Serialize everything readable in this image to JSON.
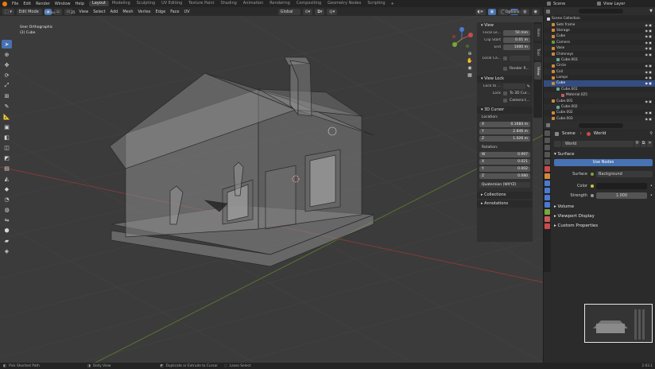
{
  "topbar": {
    "menus": [
      "File",
      "Edit",
      "Render",
      "Window",
      "Help"
    ],
    "workspaces": [
      "Layout",
      "Modeling",
      "Sculpting",
      "UV Editing",
      "Texture Paint",
      "Shading",
      "Animation",
      "Rendering",
      "Compositing",
      "Geometry Nodes",
      "Scripting"
    ],
    "active_workspace": "Layout",
    "scene": "Scene",
    "view_layer": "View Layer"
  },
  "viewport_header": {
    "mode": "Edit Mode",
    "menus": [
      "View",
      "Select",
      "Add",
      "Mesh",
      "Vertex",
      "Edge",
      "Face",
      "UV"
    ],
    "orientation": "Global",
    "options": "Options",
    "radius_label": "Radius",
    "radius_value": "25"
  },
  "viewport": {
    "view_name": "User Orthographic",
    "object_name": "(2) Cube"
  },
  "npanel": {
    "view_title": "View",
    "focal_label": "Focal Le...",
    "focal_value": "50 mm",
    "clip_start_label": "Clip Start",
    "clip_start_value": "0.01 m",
    "end_label": "End",
    "end_value": "1000 m",
    "local_camera_label": "Local Ca...",
    "render_region_label": "Render R...",
    "view_lock_title": "View Lock",
    "lock_to_label": "Lock to ...",
    "lock_label": "Lock",
    "to_3d_cursor_label": "To 3D Cur...",
    "camera_label": "Camera t...",
    "cursor_title": "3D Cursor",
    "location_label": "Location:",
    "loc_x": "0.1684 m",
    "loc_y": "2.846 m",
    "loc_z": "1.026 m",
    "rotation_label": "Rotation:",
    "rot_w": "0.997",
    "rot_x": "0.021",
    "rot_y": "0.002",
    "rot_z": "0.080",
    "rot_mode": "Quaternion (WXYZ)",
    "collections_title": "Collections",
    "annotations_title": "Annotations",
    "axis_x": "X",
    "axis_y": "Y",
    "axis_z": "Z",
    "axis_w": "W"
  },
  "ntabs": [
    "Item",
    "Tool",
    "View"
  ],
  "outliner": {
    "rows": [
      {
        "label": "Scene Collection",
        "type": "collection"
      },
      {
        "label": "Sets frame",
        "type": "mesh"
      },
      {
        "label": "Storage",
        "type": "mesh"
      },
      {
        "label": "Cube",
        "type": "mesh"
      },
      {
        "label": "Camera",
        "type": "camera"
      },
      {
        "label": "Vase",
        "type": "mesh"
      },
      {
        "label": "Chimneys",
        "type": "mesh"
      },
      {
        "label": "Cube.003",
        "type": "data"
      },
      {
        "label": "Circle",
        "type": "mesh"
      },
      {
        "label": "Coil",
        "type": "mesh"
      },
      {
        "label": "Lamps",
        "type": "mesh"
      },
      {
        "label": "Cube",
        "type": "mesh",
        "selected": true
      },
      {
        "label": "Cube.001",
        "type": "data"
      },
      {
        "label": "Material.025",
        "type": "material"
      },
      {
        "label": "Cube.001",
        "type": "mesh"
      },
      {
        "label": "Cube.002",
        "type": "data"
      },
      {
        "label": "Cube.002",
        "type": "mesh"
      },
      {
        "label": "Cube.003",
        "type": "mesh"
      }
    ]
  },
  "properties": {
    "scene_label": "Scene",
    "world_label": "World",
    "world_name": "World",
    "surface_title": "Surface",
    "use_nodes_label": "Use Nodes",
    "surface_label": "Surface",
    "surface_value": "Background",
    "color_label": "Color",
    "strength_label": "Strength",
    "strength_value": "1.000",
    "volume_title": "Volume",
    "viewport_display_title": "Viewport Display",
    "custom_props_title": "Custom Properties"
  },
  "statusbar": {
    "left": "Pick Shortest Path",
    "dolly": "Dolly View",
    "extrude": "Duplicate or Extrude to Cursor",
    "lasso": "Lasso Select",
    "version": "2.93.1"
  },
  "colors": {
    "accent": "#4772b3",
    "axis_x": "#c94b4b",
    "axis_y": "#7aa63a",
    "axis_z": "#4a7bd0"
  }
}
